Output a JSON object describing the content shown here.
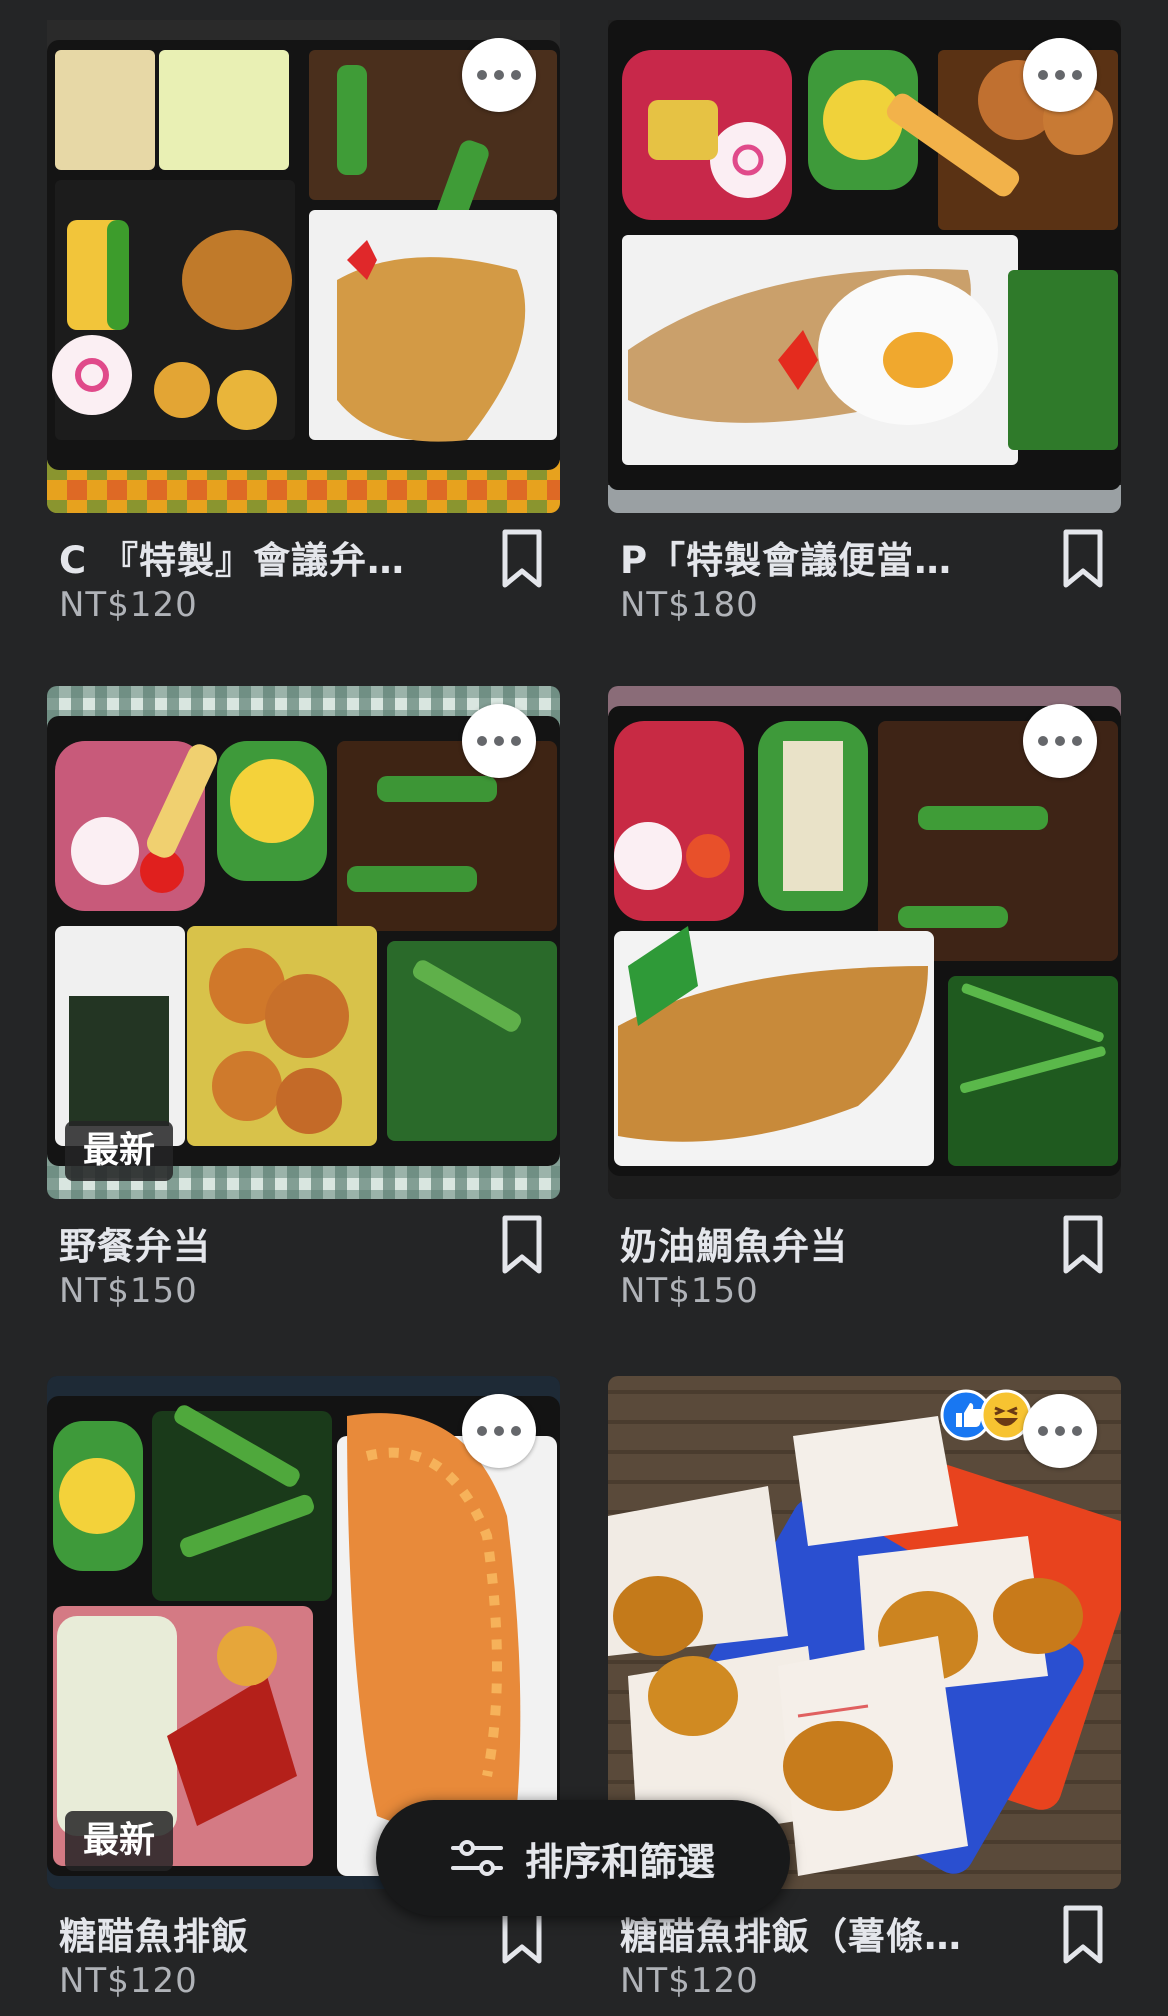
{
  "listings": [
    {
      "title": "C 『特製』會議弁…",
      "price": "NT$120",
      "badge": ""
    },
    {
      "title": "P「特製會議便當…",
      "price": "NT$180",
      "badge": ""
    },
    {
      "title": "野餐弁当",
      "price": "NT$150",
      "badge": "最新"
    },
    {
      "title": "奶油鯛魚弁当",
      "price": "NT$150",
      "badge": ""
    },
    {
      "title": "糖醋魚排飯",
      "price": "NT$120",
      "badge": "最新"
    },
    {
      "title": "糖醋魚排飯（薯條…",
      "price": "NT$120",
      "badge": ""
    }
  ],
  "sort_filter": {
    "label": "排序和篩選",
    "icon": "sliders-icon"
  },
  "icons": {
    "more": "more-icon",
    "bookmark": "bookmark-icon",
    "like": "like-icon",
    "haha": "haha-icon"
  },
  "colors": {
    "background": "#242526",
    "text": "#e4e6eb",
    "subtext": "#b0b3b8",
    "pill": "#18191a"
  }
}
